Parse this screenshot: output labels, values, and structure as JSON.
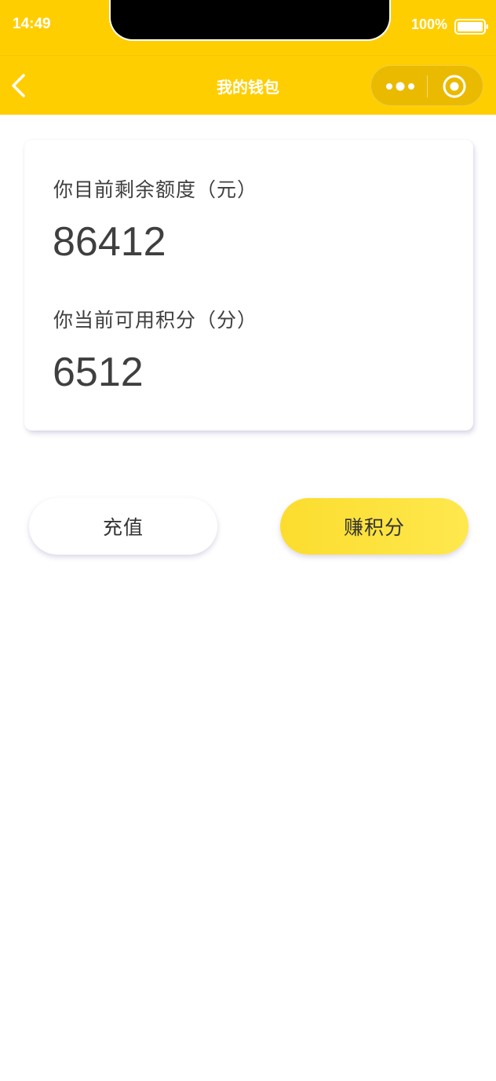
{
  "status_bar": {
    "time": "14:49",
    "battery": "100%"
  },
  "nav": {
    "title": "我的钱包",
    "back_icon": "chevron-left-icon",
    "more_icon": "more-dots-icon",
    "close_icon": "target-circle-icon"
  },
  "wallet": {
    "balance_label": "你目前剩余额度（元）",
    "balance_value": "86412",
    "points_label": "你当前可用积分（分）",
    "points_value": "6512"
  },
  "actions": {
    "recharge_label": "充值",
    "earn_points_label": "赚积分"
  },
  "colors": {
    "brand_yellow": "#FFCE00",
    "button_gradient_start": "#FCDD2E",
    "button_gradient_end": "#FEE84E",
    "text_dark": "#3F3F3F"
  }
}
